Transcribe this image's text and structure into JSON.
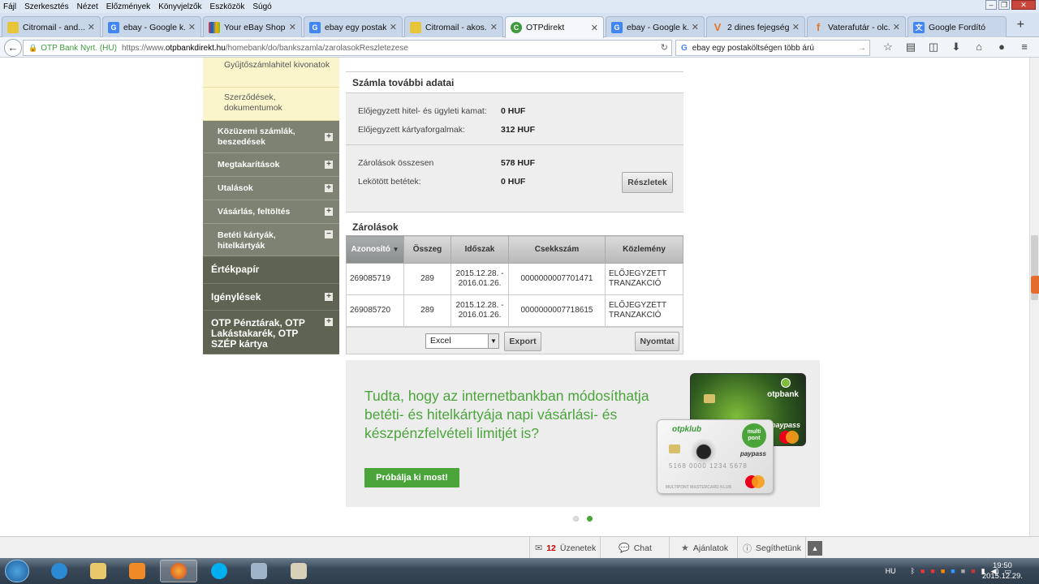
{
  "menubar": [
    "Fájl",
    "Szerkesztés",
    "Nézet",
    "Előzmények",
    "Könyvjelzők",
    "Eszközök",
    "Súgó"
  ],
  "tabs": [
    {
      "label": "Citromail - and...",
      "icon": "citromail-icon",
      "color": "#e8c43a"
    },
    {
      "label": "ebay - Google k...",
      "icon": "google-icon",
      "color": "#4285f4"
    },
    {
      "label": "Your eBay Shop...",
      "icon": "ebay-icon",
      "color": "#e53238"
    },
    {
      "label": "ebay egy postak...",
      "icon": "google-icon",
      "color": "#4285f4"
    },
    {
      "label": "Citromail - akos...",
      "icon": "citromail-icon",
      "color": "#e8c43a"
    },
    {
      "label": "OTPdirekt",
      "icon": "otp-icon",
      "color": "#3d9a3d",
      "active": true
    },
    {
      "label": "ebay - Google k...",
      "icon": "google-icon",
      "color": "#4285f4"
    },
    {
      "label": "2 dines fejegség...",
      "icon": "vatera-icon",
      "color": "#e87722"
    },
    {
      "label": "Vaterafutár - olc...",
      "icon": "vaterafutar-icon",
      "color": "#e87722"
    },
    {
      "label": "Google Fordító",
      "icon": "google-translate-icon",
      "color": "#4285f4"
    }
  ],
  "nav": {
    "org": "OTP Bank Nyrt. (HU)",
    "url_prefix": "https://www.",
    "url_domain": "otpbankdirekt.hu",
    "url_path": "/homebank/do/bankszamla/zarolasokReszletezese",
    "search": "ebay egy postaköltségen több árú"
  },
  "sidebar": {
    "yellow_items": [
      "Gyűjtőszámlahitel kivonatok",
      "Szerződések, dokumentumok"
    ],
    "items": [
      "Közüzemi számlák, beszedések",
      "Megtakarítások",
      "Utalások",
      "Vásárlás, feltöltés",
      "Betéti kártyák, hitelkártyák"
    ],
    "dark_items": [
      "Értékpapír",
      "Igénylések",
      "OTP Pénztárak, OTP Lakástakarék, OTP SZÉP kártya"
    ]
  },
  "details": {
    "title": "Számla további adatai",
    "rows": [
      {
        "label": "Előjegyzett hitel- és ügyleti kamat:",
        "value": "0 HUF"
      },
      {
        "label": "Előjegyzett kártyaforgalmak:",
        "value": "312 HUF"
      }
    ],
    "rows2": [
      {
        "label": "Zárolások összesen",
        "value": "578 HUF"
      },
      {
        "label": "Lekötött betétek:",
        "value": "0 HUF"
      }
    ],
    "details_button": "Részletek"
  },
  "locks": {
    "title": "Zárolások",
    "columns": [
      "Azonosító",
      "Összeg",
      "Időszak",
      "Csekkszám",
      "Közlemény"
    ],
    "rows": [
      {
        "id": "269085719",
        "amount": "289",
        "period": "2015.12.28. - 2016.01.26.",
        "check": "0000000007701471",
        "note": "ELŐJEGYZETT TRANZAKCIÓ"
      },
      {
        "id": "269085720",
        "amount": "289",
        "period": "2015.12.28. - 2016.01.26.",
        "check": "0000000007718615",
        "note": "ELŐJEGYZETT TRANZAKCIÓ"
      }
    ],
    "export_format": "Excel",
    "export_button": "Export",
    "print_button": "Nyomtat"
  },
  "banner": {
    "text": "Tudta, hogy az internetbankban módosíthatja betéti- és hitelkártyája napi vásárlási- és készpénzfelvételi limitjét is?",
    "button": "Próbálja ki most!",
    "card1_brand": "otpbank",
    "card1_paypass": "paypass",
    "card2_brand": "otpklub",
    "card2_paypass": "paypass",
    "card2_multipont": "multi pont",
    "card2_number": "5168 0000 1234 5678",
    "card2_footer": "MULTIPONT MASTERCARD KLUB",
    "mastercard": "MasterCard"
  },
  "util": {
    "messages_count": "12",
    "messages": "Üzenetek",
    "chat": "Chat",
    "offers": "Ajánlatok",
    "help": "Segíthetünk"
  },
  "taskbar": {
    "lang": "HU",
    "time": "19:50",
    "date": "2015.12.29."
  },
  "colors": {
    "accent_green": "#4aa43a",
    "sidebar_gray": "#7d8272",
    "sidebar_dark": "#5f6452"
  }
}
